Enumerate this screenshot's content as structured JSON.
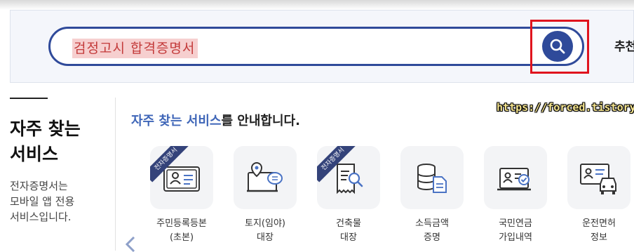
{
  "search": {
    "query": "검정고시 합격증명서",
    "recommend_label": "추천"
  },
  "sidebar": {
    "title_line1": "자주 찾는",
    "title_line2": "서비스",
    "desc_line1": "전자증명서는",
    "desc_line2": "모바일 앱 전용",
    "desc_line3": "서비스입니다."
  },
  "main": {
    "headline_accent": "자주 찾는 서비스",
    "headline_rest": "를 안내합니다.",
    "watermark": "https://forced.tistory.com",
    "services": [
      {
        "label": "주민등록등본\n(초본)",
        "badge": "전자증명서",
        "icon": "id-card-icon"
      },
      {
        "label": "토지(임야)\n대장",
        "badge": "",
        "icon": "land-map-icon"
      },
      {
        "label": "건축물\n대장",
        "badge": "전자증명서",
        "icon": "building-register-icon"
      },
      {
        "label": "소득금액\n증명",
        "badge": "",
        "icon": "income-certificate-icon"
      },
      {
        "label": "국민연금\n가입내역",
        "badge": "",
        "icon": "pension-icon"
      },
      {
        "label": "운전면허\n정보",
        "badge": "",
        "icon": "driver-license-icon"
      }
    ]
  },
  "colors": {
    "accent": "#2f4a9a",
    "highlight_border": "#e0141e",
    "headline_accent": "#3f66b8"
  }
}
